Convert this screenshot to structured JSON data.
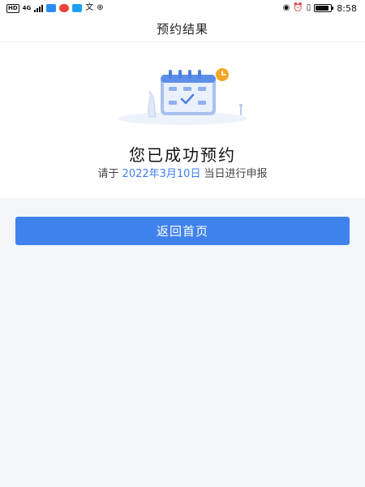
{
  "status_bar": {
    "left_badge": "HD",
    "network": "4G",
    "time": "8:58",
    "battery_level": 0.9,
    "icons": [
      "hd-icon",
      "signal-icon",
      "chat-app-icon",
      "weibo-icon",
      "qq-icon",
      "translate-icon",
      "browser-icon",
      "eye-icon",
      "alarm-icon",
      "vibrate-icon",
      "battery-icon"
    ]
  },
  "header": {
    "title": "预约结果"
  },
  "result": {
    "title": "您已成功预约",
    "prefix": "请于",
    "date": "2022年3月10日",
    "suffix": "当日进行申报"
  },
  "actions": {
    "back_label": "返回首页"
  },
  "colors": {
    "accent": "#3f82ee",
    "date_text": "#3d7ef0",
    "page_bg": "#f3f5f9",
    "clock_badge": "#f5a623"
  }
}
